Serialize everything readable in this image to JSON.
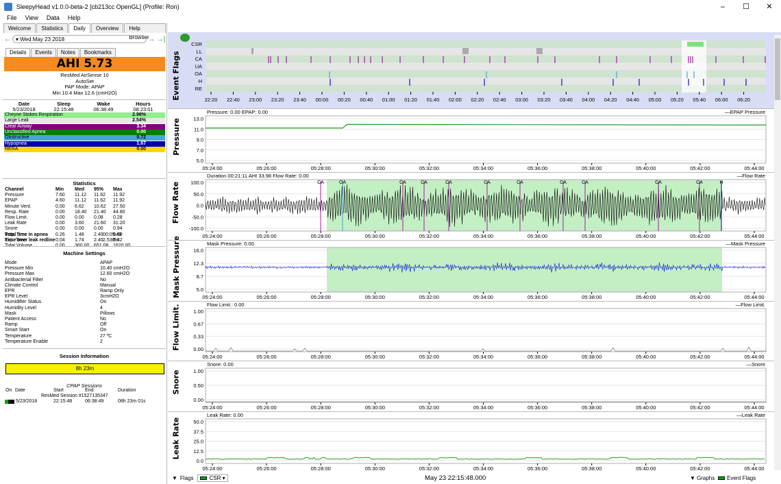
{
  "window": {
    "title": "SleepyHead v1.0.0-beta-2 [cb213cc OpenGL] (Profile: Ron)",
    "controls": [
      "–",
      "☐",
      "✕"
    ]
  },
  "menu": [
    "File",
    "View",
    "Data",
    "Help"
  ],
  "main_tabs": [
    "Welcome",
    "Statistics",
    "Daily",
    "Overview",
    "Help Browser"
  ],
  "date": "Wed May 23 2018",
  "sub_tabs": [
    "Details",
    "Events",
    "Notes",
    "Bookmarks"
  ],
  "ahi": "AHI 5.73",
  "device": {
    "line1": "ResMed AirSense 10",
    "line2": "AutoSet",
    "line3": "PAP Mode: APAP",
    "line4": "Min 10.4 Max 12.6 (cmH2O)"
  },
  "sleep": {
    "headers": [
      "Date",
      "Sleep",
      "Wake",
      "Hours"
    ],
    "values": [
      "5/23/2018",
      "22:15:48",
      "06:38:49",
      "08:23:01"
    ]
  },
  "events": [
    {
      "name": "Cheyne Stokes Respiration",
      "value": "2.98%",
      "bg": "#90ee90",
      "fg": "#000"
    },
    {
      "name": "Large Leak",
      "value": "2.54%",
      "bg": "#e8e8e8",
      "fg": "#000"
    },
    {
      "name": "Clear Airway",
      "value": "3.34",
      "bg": "#800080",
      "fg": "#ffffff"
    },
    {
      "name": "Unclassified Apnea",
      "value": "0.00",
      "bg": "#008000",
      "fg": "#ffffff"
    },
    {
      "name": "Obstructive",
      "value": "0.72",
      "bg": "#4aa3df",
      "fg": "#000"
    },
    {
      "name": "Hypopnea",
      "value": "1.67",
      "bg": "#0000b0",
      "fg": "#ffffff"
    },
    {
      "name": "RERA",
      "value": "0.00",
      "bg": "#ffd700",
      "fg": "#000"
    }
  ],
  "stats": {
    "title": "Statistics",
    "headers": [
      "Channel",
      "Min",
      "Med",
      "95%",
      "Max"
    ],
    "rows": [
      [
        "Pressure",
        "7.60",
        "11.12",
        "11.62",
        "11.92"
      ],
      [
        "EPAP",
        "4.60",
        "11.12",
        "11.62",
        "11.92"
      ],
      [
        "Minute Vent.",
        "0.00",
        "6.62",
        "10.62",
        "27.50"
      ],
      [
        "Resp. Rate",
        "0.00",
        "18.40",
        "21.40",
        "44.80"
      ],
      [
        "Flow Limit.",
        "0.00",
        "0.00",
        "0.08",
        "0.28"
      ],
      [
        "Leak Rate",
        "0.00",
        "3.60",
        "21.60",
        "31.20"
      ],
      [
        "Snore",
        "0.00",
        "0.00",
        "0.00",
        "0.94"
      ],
      [
        "Insp. Time",
        "0.26",
        "1.48",
        "2.40",
        "9.60"
      ],
      [
        "Exp. Time",
        "0.04",
        "1.74",
        "2.40",
        "5.42"
      ],
      [
        "Tidal Volume",
        "0.00",
        "360.00",
        "651.08",
        "1620.00"
      ]
    ]
  },
  "apnea": {
    "l1": "Total time in apnea",
    "v1": "00:09:49",
    "l2": "Time over leak redline",
    "v2": "2.538%"
  },
  "machine": {
    "title": "Machine Settings",
    "rows": [
      [
        "Mode",
        "APAP"
      ],
      [
        "Pressure Min",
        "10.40 cmH2O"
      ],
      [
        "Pressure Max",
        "12.60 cmH2O"
      ],
      [
        "Antibacterial Filter",
        "No"
      ],
      [
        "Climate Control",
        "Manual"
      ],
      [
        "EPR",
        "Ramp Only"
      ],
      [
        "EPR Level",
        "3cmH2O"
      ],
      [
        "Humidifier Status",
        "On"
      ],
      [
        "Humidity Level",
        "4"
      ],
      [
        "Mask",
        "Pillows"
      ],
      [
        "Patient Access",
        "No"
      ],
      [
        "Ramp",
        "Off"
      ],
      [
        "Smart Start",
        "On"
      ],
      [
        "Temperature",
        "27 ºC"
      ],
      [
        "Temperature Enable",
        "2"
      ]
    ]
  },
  "session": {
    "title": "Session Information",
    "bar": "8h 23m",
    "cpap_title": "CPAP Sessions",
    "headers": [
      "On",
      "Date",
      "Start",
      "End",
      "Duration"
    ],
    "name": "ResMed Session #1527135347",
    "date": "5/23/2018",
    "start": "22:15:48",
    "end": "06:38:49",
    "duration": "08h 23m 01s"
  },
  "event_flags": {
    "label": "Event Flags",
    "rows": [
      "CSR",
      "LL",
      "CA",
      "UA",
      "OA",
      "H",
      "RE"
    ],
    "ticks": [
      "22:20",
      "22:40",
      "23:00",
      "23:20",
      "23:40",
      "00:00",
      "00:20",
      "00:40",
      "01:00",
      "01:20",
      "01:40",
      "02:00",
      "02:20",
      "02:40",
      "03:00",
      "03:20",
      "03:40",
      "04:00",
      "04:20",
      "04:40",
      "05:00",
      "05:20",
      "05:40",
      "06:00",
      "06:20"
    ]
  },
  "x_ticks": [
    "05:24:00",
    "05:26:00",
    "05:28:00",
    "05:30:00",
    "05:32:00",
    "05:34:00",
    "05:36:00",
    "05:38:00",
    "05:40:00",
    "05:42:00",
    "05:44:00"
  ],
  "charts": [
    {
      "label": "Pressure",
      "title": "Pressure: 0.00 EPAP: 0.00",
      "legend": "EPAP  Pressure",
      "yticks": [
        "13.0",
        "11.0",
        "9.0",
        "7.0",
        "5.0"
      ]
    },
    {
      "label": "Flow Rate",
      "title": "Duration 00:21:11 AHI 33.98 Flow Rate: 0.00",
      "legend": "Flow Rate",
      "yticks": [
        "100.0",
        "50.0",
        "0.0",
        "-50.0",
        "-100.0"
      ]
    },
    {
      "label": "Mask Pressure",
      "title": "Mask Pressure: 0.00",
      "legend": "Mask Pressure",
      "yticks": [
        "16.0",
        "12.3",
        "8.7",
        "5.0"
      ]
    },
    {
      "label": "Flow Limit.",
      "title": "Flow Limit.: 0.00",
      "legend": "Flow Limit.",
      "yticks": [
        "1.00",
        "0.67",
        "0.33",
        "0.00"
      ]
    },
    {
      "label": "Snore",
      "title": "Snore: 0.00",
      "legend": "Snore",
      "yticks": [
        "1.00",
        "0.50",
        "0.00"
      ]
    },
    {
      "label": "Leak Rate",
      "title": "Leak Rate: 0.00",
      "legend": "Leak Rate",
      "yticks": [
        "50.0",
        "37.5",
        "25.0",
        "12.5",
        "0.0"
      ]
    }
  ],
  "flow_events": [
    "CA",
    "OA",
    "CA",
    "CA",
    "CA",
    "CA",
    "CA",
    "CA",
    "CA",
    "CA",
    "CA",
    "H"
  ],
  "bottom": {
    "flags": "Flags",
    "csr": "CSR",
    "time": "May 23 22:15:48.000",
    "graphs": "Graphs",
    "event_flags": "Event Flags"
  }
}
